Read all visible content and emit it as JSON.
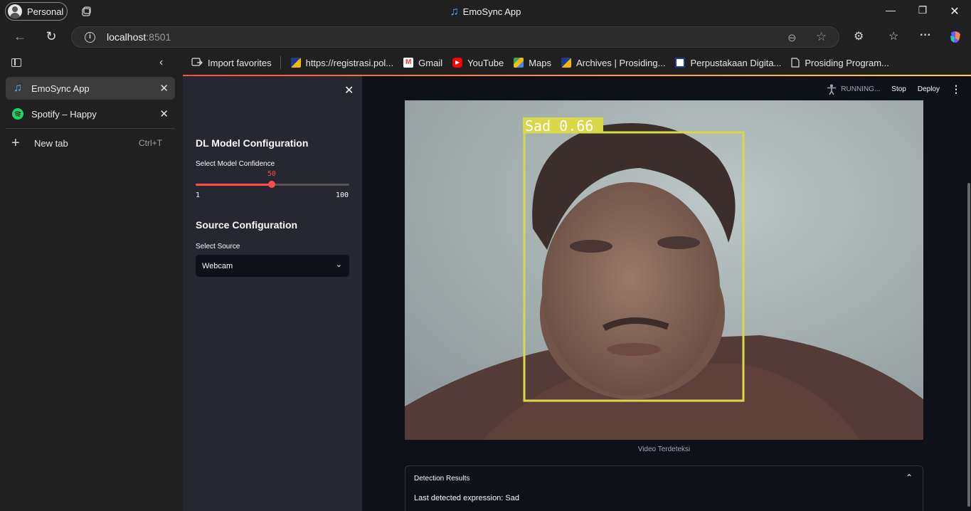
{
  "browser": {
    "profile_label": "Personal",
    "window_title": "EmoSync App",
    "url_host": "localhost",
    "url_port": ":8501",
    "favorites": [
      {
        "label": "Import favorites",
        "icon": "import-icon"
      },
      {
        "label": "https://registrasi.pol...",
        "icon": "site-icon"
      },
      {
        "label": "Gmail",
        "icon": "gmail-icon"
      },
      {
        "label": "YouTube",
        "icon": "youtube-icon"
      },
      {
        "label": "Maps",
        "icon": "maps-icon"
      },
      {
        "label": "Archives | Prosiding...",
        "icon": "site-icon"
      },
      {
        "label": "Perpustakaan Digita...",
        "icon": "site-icon"
      },
      {
        "label": "Prosiding Program...",
        "icon": "document-icon"
      }
    ],
    "tabs": [
      {
        "label": "EmoSync App",
        "icon": "music-note-icon",
        "active": true
      },
      {
        "label": "Spotify – Happy",
        "icon": "spotify-icon",
        "active": false
      }
    ],
    "new_tab_label": "New tab",
    "new_tab_shortcut": "Ctrl+T"
  },
  "app": {
    "sidebar": {
      "model_header": "DL Model Configuration",
      "confidence_label": "Select Model Confidence",
      "confidence_value": "50",
      "confidence_min": "1",
      "confidence_max": "100",
      "source_header": "Source Configuration",
      "source_label": "Select Source",
      "source_value": "Webcam"
    },
    "toolbar": {
      "status": "RUNNING...",
      "stop": "Stop",
      "deploy": "Deploy"
    },
    "video": {
      "detection_label": "Sad 0.66",
      "box_color": "#d8d84a",
      "caption": "Video Terdeteksi"
    },
    "results": {
      "title": "Detection Results",
      "last_expression": "Last detected expression: Sad"
    }
  },
  "colors": {
    "accent": "#ff4b4b",
    "app_bg": "#0e1117",
    "sidebar_bg": "#262730",
    "browser_bg": "#202020"
  }
}
